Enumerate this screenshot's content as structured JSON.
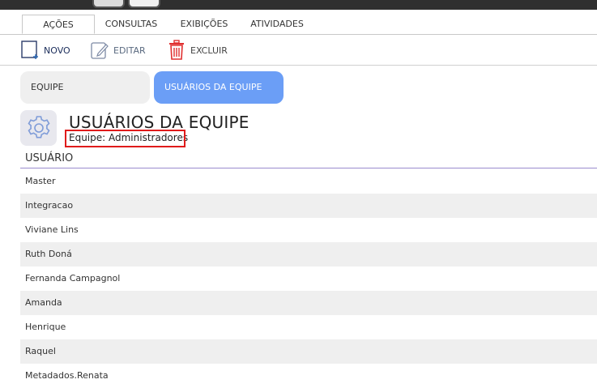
{
  "tabs": [
    {
      "label": "AÇÕES"
    },
    {
      "label": "CONSULTAS"
    },
    {
      "label": "EXIBIÇÕES"
    },
    {
      "label": "ATIVIDADES"
    }
  ],
  "toolbar": {
    "novo": {
      "label": "NOVO",
      "icon": "new-document-icon"
    },
    "editar": {
      "label": "EDITAR",
      "icon": "edit-icon"
    },
    "excluir": {
      "label": "EXCLUIR",
      "icon": "trash-icon"
    }
  },
  "subtabs": {
    "equipe": "EQUIPE",
    "usuarios": "USUÁRIOS DA EQUIPE"
  },
  "header": {
    "icon": "gear-icon",
    "title": "USUÁRIOS DA EQUIPE",
    "subtitle": "Equipe: Administradores"
  },
  "table": {
    "column": "USUÁRIO",
    "rows": [
      "Master",
      "Integracao",
      "Viviane Lins",
      "Ruth Doná",
      "Fernanda Campagnol",
      "Amanda",
      "Henrique",
      "Raquel",
      "Metadados.Renata"
    ]
  },
  "colors": {
    "accent": "#6b9ef6",
    "highlight": "#e01b1b",
    "trash": "#e03030"
  }
}
